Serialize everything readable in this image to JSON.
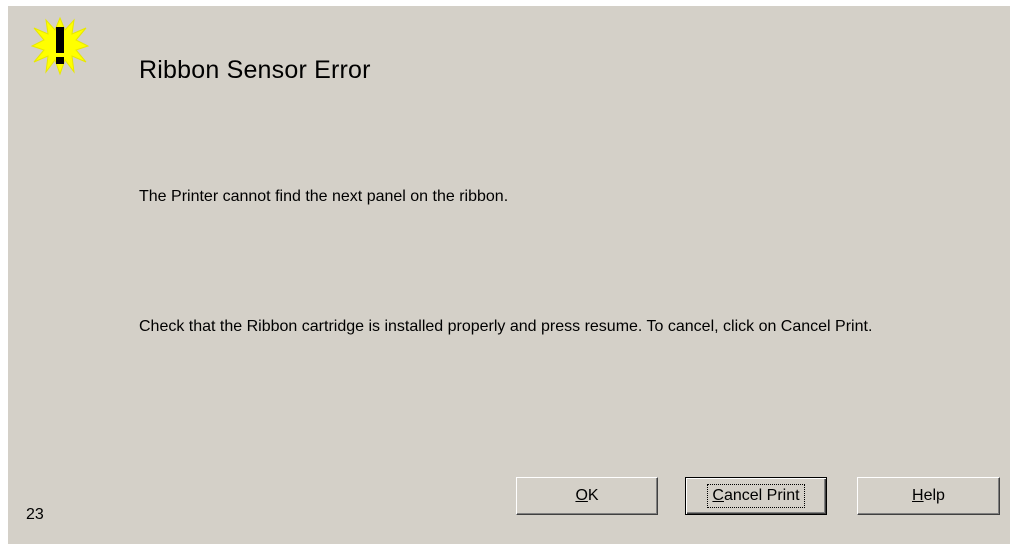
{
  "dialog": {
    "title": "Ribbon Sensor Error",
    "message_line": "The Printer cannot find the next panel on the ribbon.",
    "instructions": "Check that the Ribbon cartridge is installed properly and press resume. To cancel, click on Cancel Print.",
    "error_code": "23",
    "icon": "warning-exclamation-icon",
    "icon_color": "#ffff00"
  },
  "buttons": {
    "ok": {
      "access_key": "O",
      "rest": "K"
    },
    "cancel_print": {
      "access_key": "C",
      "rest": "ancel Print"
    },
    "help": {
      "access_key": "H",
      "rest": "elp"
    }
  },
  "colors": {
    "dialog_background": "#d4d0c8",
    "text": "#000000"
  }
}
